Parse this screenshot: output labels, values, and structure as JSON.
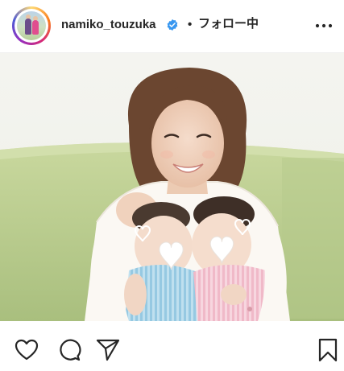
{
  "post": {
    "username": "namiko_touzuka",
    "separator": "•",
    "follow_status": "フォロー中"
  },
  "icons": {
    "verified": "verified-badge-icon",
    "more": "more-options-icon",
    "like": "heart-icon",
    "comment": "comment-icon",
    "share": "paper-plane-icon",
    "save": "bookmark-icon"
  },
  "colors": {
    "verified_blue": "#3897f0",
    "text": "#262626",
    "divider": "#efefef"
  }
}
